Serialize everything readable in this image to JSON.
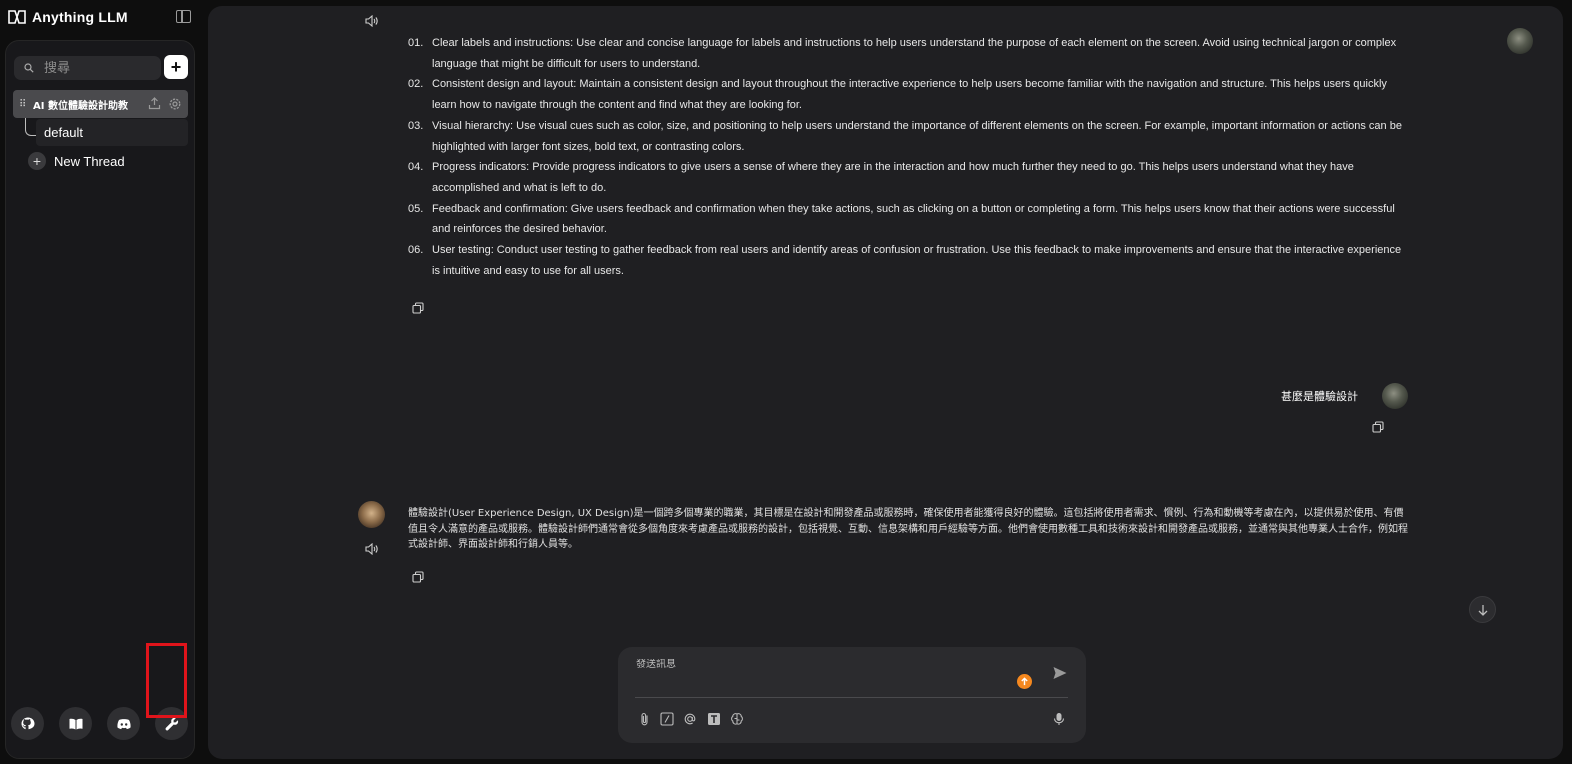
{
  "app": {
    "brand": "Anything LLM"
  },
  "sidebar": {
    "search_placeholder": "搜尋",
    "workspace": {
      "name": "AI 數位體驗設計助教"
    },
    "threads": [
      {
        "label": "default"
      }
    ],
    "new_thread_label": "New Thread",
    "footer": [
      {
        "icon": "github-icon"
      },
      {
        "icon": "book-icon"
      },
      {
        "icon": "discord-icon"
      },
      {
        "icon": "wrench-icon"
      }
    ]
  },
  "chat": {
    "list_items": [
      {
        "num": "01.",
        "text": "Clear labels and instructions: Use clear and concise language for labels and instructions to help users understand the purpose of each element on the screen. Avoid using technical jargon or complex language that might be difficult for users to understand."
      },
      {
        "num": "02.",
        "text": "Consistent design and layout: Maintain a consistent design and layout throughout the interactive experience to help users become familiar with the navigation and structure. This helps users quickly learn how to navigate through the content and find what they are looking for."
      },
      {
        "num": "03.",
        "text": "Visual hierarchy: Use visual cues such as color, size, and positioning to help users understand the importance of different elements on the screen. For example, important information or actions can be highlighted with larger font sizes, bold text, or contrasting colors."
      },
      {
        "num": "04.",
        "text": "Progress indicators: Provide progress indicators to give users a sense of where they are in the interaction and how much further they need to go. This helps users understand what they have accomplished and what is left to do."
      },
      {
        "num": "05.",
        "text": "Feedback and confirmation: Give users feedback and confirmation when they take actions, such as clicking on a button or completing a form. This helps users know that their actions were successful and reinforces the desired behavior."
      },
      {
        "num": "06.",
        "text": "User testing: Conduct user testing to gather feedback from real users and identify areas of confusion or frustration. Use this feedback to make improvements and ensure that the interactive experience is intuitive and easy to use for all users."
      }
    ],
    "user_question": "甚麼是體驗設計",
    "answer": "體驗設計(User Experience Design, UX Design)是一個跨多個專業的職業，其目標是在設計和開發產品或服務時，確保使用者能獲得良好的體驗。這包括將使用者需求、慣例、行為和動機等考慮在內，以提供易於使用、有價值且令人滿意的產品或服務。體驗設計師們通常會從多個角度來考慮產品或服務的設計，包括視覺、互動、信息架構和用戶經驗等方面。他們會使用數種工具和技術來設計和開發產品或服務，並通常與其他專業人士合作，例如程式設計師、界面設計師和行銷人員等。"
  },
  "composer": {
    "placeholder": "發送訊息"
  },
  "colors": {
    "highlight": "#e0141b",
    "badge": "#f5881f"
  }
}
